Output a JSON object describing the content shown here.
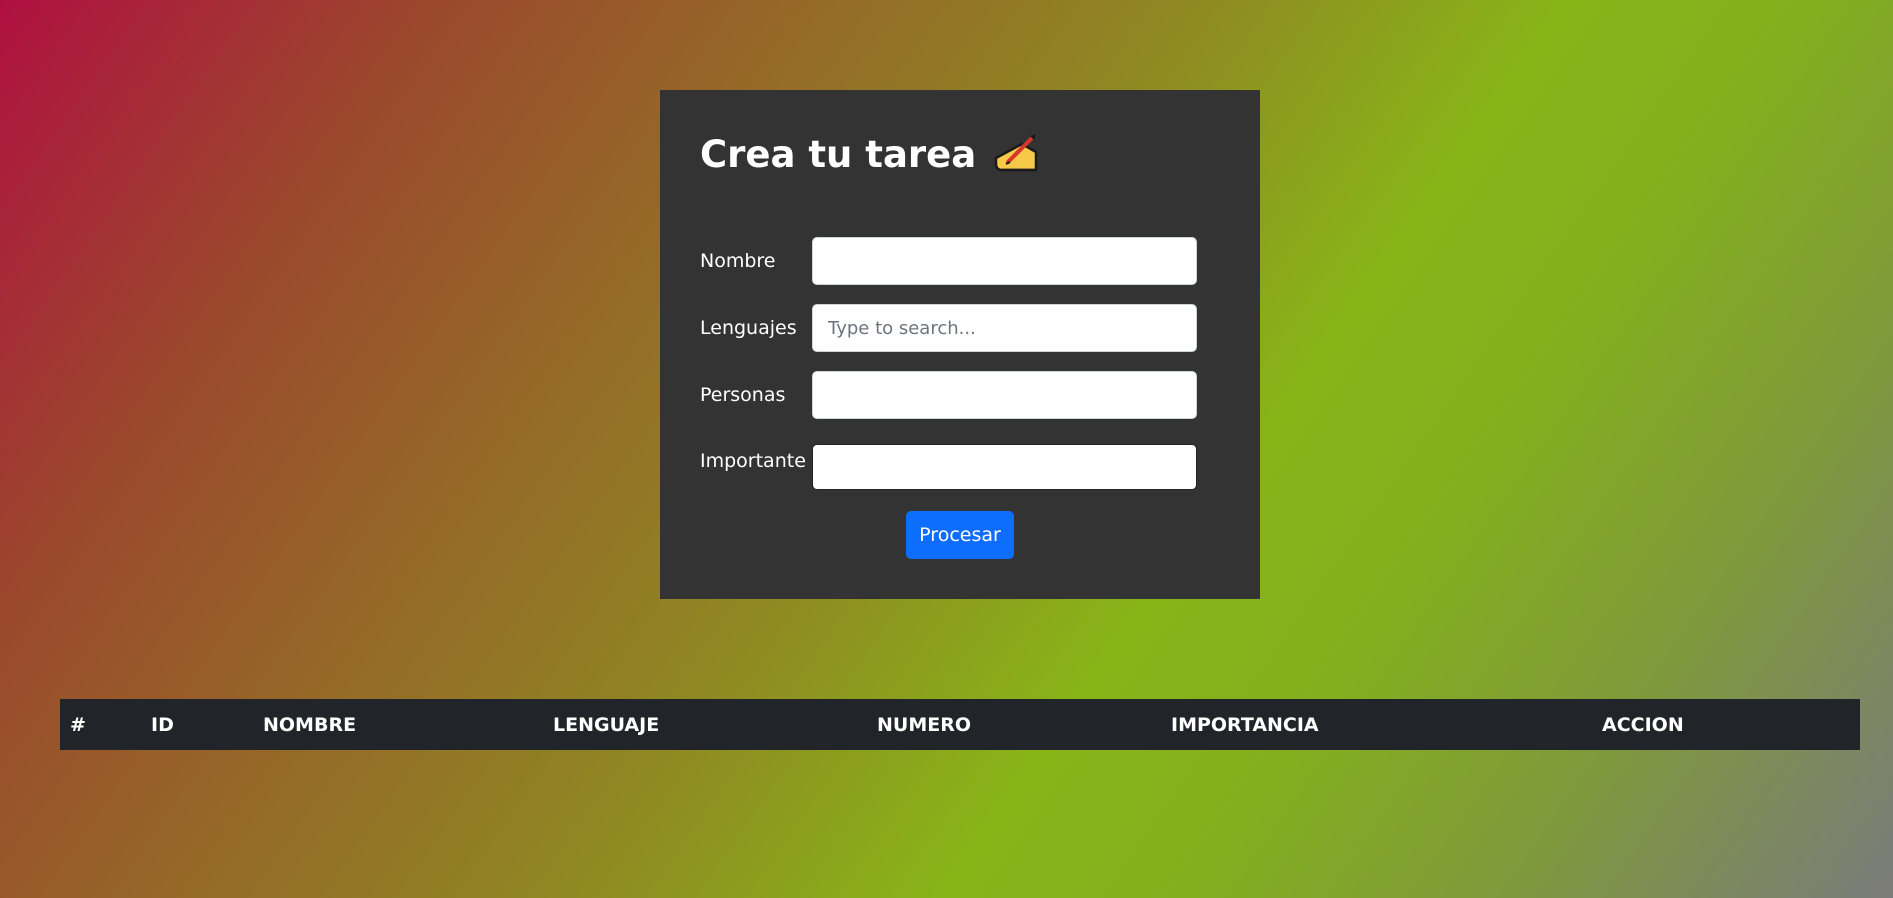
{
  "form": {
    "title": "Crea tu tarea",
    "title_icon": "writing-hand-icon",
    "fields": [
      {
        "label": "Nombre",
        "value": "",
        "placeholder": ""
      },
      {
        "label": "Lenguajes",
        "value": "",
        "placeholder": "Type to search..."
      },
      {
        "label": "Personas",
        "value": "",
        "placeholder": ""
      },
      {
        "label": "Importante",
        "value": "",
        "placeholder": ""
      }
    ],
    "submit_label": "Procesar"
  },
  "table": {
    "columns": [
      "#",
      "ID",
      "NOMBRE",
      "LENGUAJE",
      "NUMERO",
      "IMPORTANCIA",
      "ACCION"
    ],
    "rows": []
  },
  "colors": {
    "card_background": "#333333",
    "button": "#0d6efd",
    "table_header": "#212529"
  }
}
